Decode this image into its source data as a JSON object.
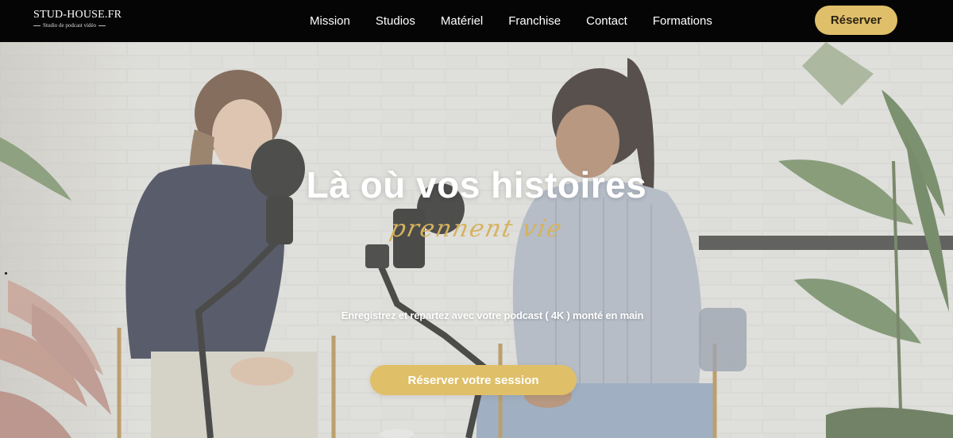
{
  "header": {
    "logo_title": "STUD-HOUSE.FR",
    "logo_subtitle": "Studio de podcast vidéo",
    "nav": [
      "Mission",
      "Studios",
      "Matériel",
      "Franchise",
      "Contact",
      "Formations"
    ],
    "cta_label": "Réserver"
  },
  "hero": {
    "title": "Là où vos histoires",
    "title_script": "prennent vie",
    "subtitle": "Enregistrez et repartez avec votre podcast ( 4K ) monté en main",
    "cta_label": "Réserver votre session"
  },
  "colors": {
    "nav_bg": "#050505",
    "accent_gold": "#e0bf6a",
    "script_gold": "#d6b25c",
    "white": "#ffffff"
  }
}
